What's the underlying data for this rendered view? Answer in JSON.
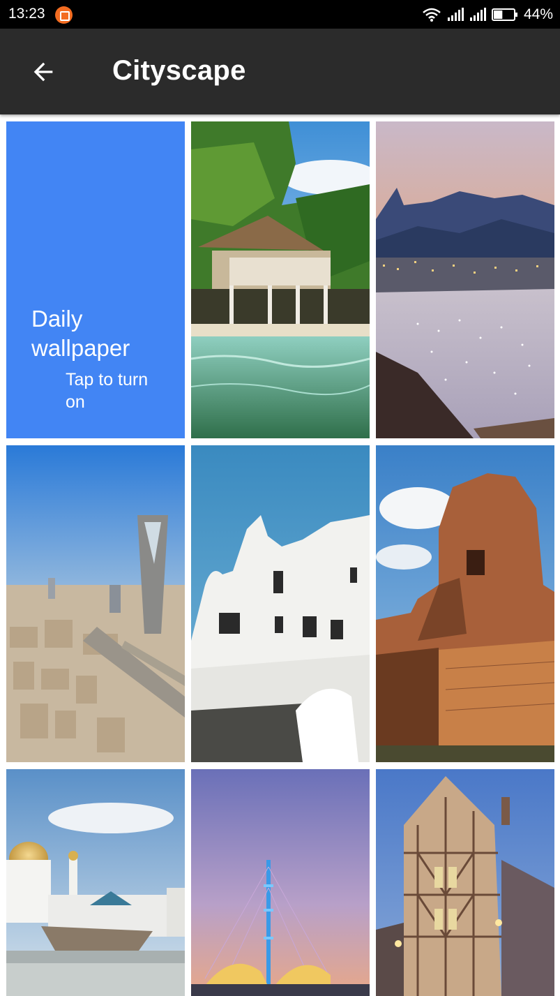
{
  "status_bar": {
    "time": "13:23",
    "battery_percent": "44%",
    "battery_level": 0.44,
    "icons": [
      "notification-icon",
      "wifi-icon",
      "signal-icon",
      "signal-icon",
      "battery-icon"
    ]
  },
  "app_bar": {
    "title": "Cityscape",
    "back_icon": "arrow-back-icon"
  },
  "daily_wallpaper": {
    "title": "Daily wallpaper",
    "action": "Tap to turn on",
    "icon": "refresh-icon",
    "background_color": "#4285f4"
  },
  "wallpapers": [
    {
      "subject": "tropical-beach-hut"
    },
    {
      "subject": "bay-with-boats-and-mountains"
    },
    {
      "subject": "city-skyline-with-tower"
    },
    {
      "subject": "white-sculptural-building"
    },
    {
      "subject": "ancient-brick-temple"
    },
    {
      "subject": "mosque-with-golden-dome"
    },
    {
      "subject": "illuminated-mast-structure-at-dusk"
    },
    {
      "subject": "half-timbered-house-at-dusk"
    }
  ],
  "colors": {
    "status_bar": "#000000",
    "app_bar": "#2b2b2b",
    "accent": "#4285f4"
  }
}
